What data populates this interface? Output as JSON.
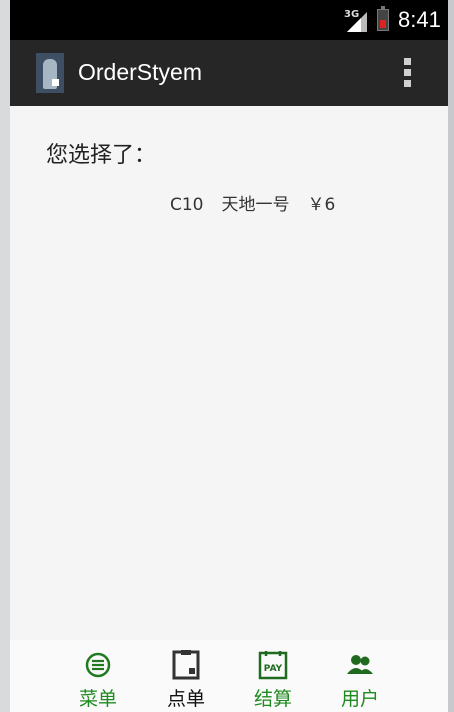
{
  "status_bar": {
    "network": "3G",
    "time": "8:41"
  },
  "action_bar": {
    "title": "OrderStyem"
  },
  "main": {
    "prompt": "您选择了：",
    "selected_item": {
      "code": "C10",
      "name": "天地一号",
      "price": "￥6"
    }
  },
  "bottom_nav": {
    "items": [
      {
        "label": "菜单",
        "icon": "menu-list-icon",
        "color": "#1f8a1f"
      },
      {
        "label": "点单",
        "icon": "clipboard-icon",
        "color": "#111111"
      },
      {
        "label": "结算",
        "icon": "pay-icon",
        "color": "#1f8a1f"
      },
      {
        "label": "用户",
        "icon": "users-icon",
        "color": "#1f8a1f"
      }
    ]
  },
  "colors": {
    "accent": "#1f8a1f",
    "action_bar": "#262626",
    "status_bar": "#000000"
  }
}
